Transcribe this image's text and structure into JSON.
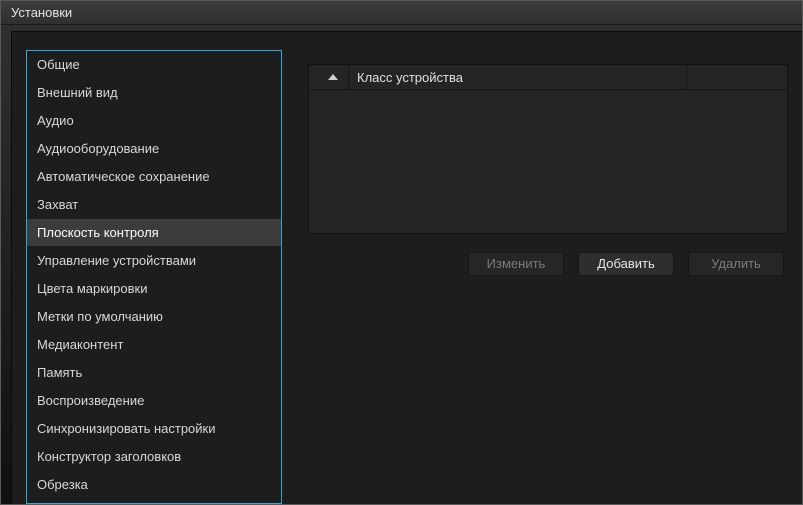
{
  "window": {
    "title": "Установки"
  },
  "sidebar": {
    "items": [
      {
        "label": "Общие"
      },
      {
        "label": "Внешний вид"
      },
      {
        "label": "Аудио"
      },
      {
        "label": "Аудиооборудование"
      },
      {
        "label": "Автоматическое сохранение"
      },
      {
        "label": "Захват"
      },
      {
        "label": "Плоскость контроля"
      },
      {
        "label": "Управление устройствами"
      },
      {
        "label": "Цвета маркировки"
      },
      {
        "label": "Метки по умолчанию"
      },
      {
        "label": "Медиаконтент"
      },
      {
        "label": "Память"
      },
      {
        "label": "Воспроизведение"
      },
      {
        "label": "Синхронизировать настройки"
      },
      {
        "label": "Конструктор заголовков"
      },
      {
        "label": "Обрезка"
      }
    ],
    "selected_index": 6
  },
  "table": {
    "columns": {
      "device_class": "Класс устройства"
    },
    "rows": []
  },
  "buttons": {
    "edit": "Изменить",
    "add": "Добавить",
    "delete": "Удалить"
  }
}
